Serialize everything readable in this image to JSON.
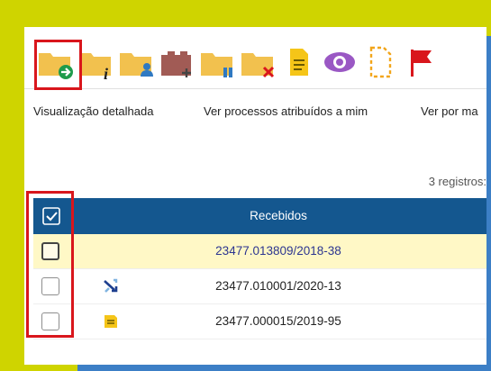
{
  "toolbar": {
    "icons": [
      {
        "name": "send-process-icon"
      },
      {
        "name": "process-info-icon"
      },
      {
        "name": "assign-user-icon"
      },
      {
        "name": "add-document-icon"
      },
      {
        "name": "suspend-process-icon"
      },
      {
        "name": "remove-process-icon"
      },
      {
        "name": "note-icon"
      },
      {
        "name": "view-icon"
      },
      {
        "name": "dashed-document-icon"
      },
      {
        "name": "flag-icon"
      }
    ]
  },
  "actions": {
    "detailed_view": "Visualização detalhada",
    "assigned_to_me": "Ver processos atribuídos a mim",
    "view_by": "Ver por ma"
  },
  "table": {
    "count_label": "3 registros:",
    "header": "Recebidos",
    "rows": [
      {
        "number": "23477.013809/2018-38",
        "selected": true,
        "icon": ""
      },
      {
        "number": "23477.010001/2020-13",
        "selected": false,
        "icon": "shuffle-arrows-icon"
      },
      {
        "number": "23477.000015/2019-95",
        "selected": false,
        "icon": "note-icon"
      }
    ]
  },
  "colors": {
    "accent_yellow": "#cfd400",
    "header_blue": "#14578f",
    "highlight_red": "#d9161c",
    "folder": "#f2c14e",
    "selected_row": "#fff8c6"
  }
}
